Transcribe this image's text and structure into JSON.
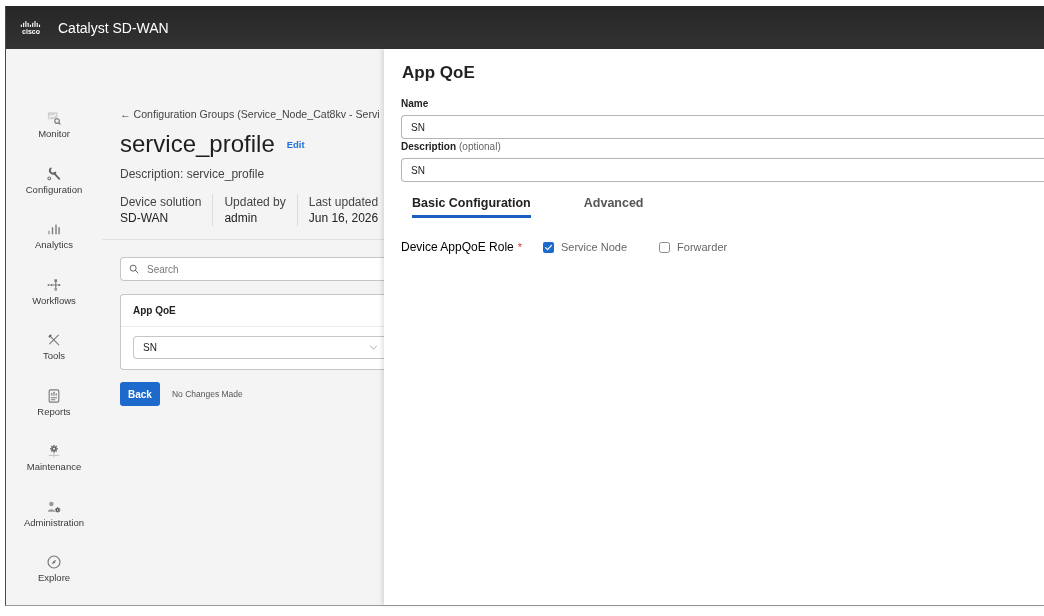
{
  "header": {
    "logo_text": "cisco",
    "product": "Catalyst SD-WAN"
  },
  "sidebar": {
    "items": [
      {
        "label": "Monitor"
      },
      {
        "label": "Configuration"
      },
      {
        "label": "Analytics"
      },
      {
        "label": "Workflows"
      },
      {
        "label": "Tools"
      },
      {
        "label": "Reports"
      },
      {
        "label": "Maintenance"
      },
      {
        "label": "Administration"
      },
      {
        "label": "Explore"
      }
    ]
  },
  "page": {
    "breadcrumb": "← Configuration Groups (Service_Node_Cat8kv - Servi",
    "title": "service_profile",
    "edit_link": "Edit",
    "description": "Description: service_profile",
    "meta": [
      {
        "label": "Device solution",
        "value": "SD-WAN"
      },
      {
        "label": "Updated by",
        "value": "admin"
      },
      {
        "label": "Last updated",
        "value": "Jun 16, 2026"
      }
    ],
    "search": {
      "placeholder": "Search"
    },
    "card": {
      "title": "App QoE",
      "select": {
        "value": "SN"
      }
    },
    "back_button": "Back",
    "status": "No Changes Made"
  },
  "panel": {
    "title": "App QoE",
    "fields": [
      {
        "label": "Name",
        "value": "SN"
      },
      {
        "label": "Description",
        "hint": "(optional)",
        "value": "SN"
      }
    ],
    "tabs": [
      {
        "label": "Basic Configuration",
        "selected": true
      },
      {
        "label": "Advanced",
        "selected": false
      }
    ],
    "role": {
      "label": "Device AppQoE Role",
      "required_mark": "*",
      "options": [
        {
          "label": "Service Node",
          "checked": true
        },
        {
          "label": "Forwarder",
          "checked": false
        }
      ]
    }
  }
}
